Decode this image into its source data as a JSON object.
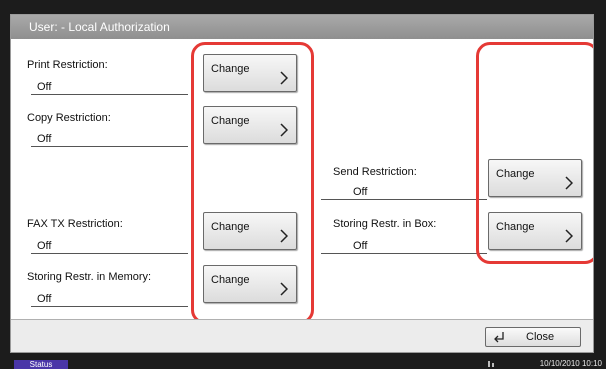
{
  "window": {
    "title": "User: - Local Authorization"
  },
  "rows": {
    "print": {
      "label": "Print Restriction:",
      "value": "Off",
      "button": "Change"
    },
    "copy": {
      "label": "Copy Restriction:",
      "value": "Off",
      "button": "Change"
    },
    "send": {
      "label": "Send Restriction:",
      "value": "Off",
      "button": "Change"
    },
    "fax": {
      "label": "FAX TX Restriction:",
      "value": "Off",
      "button": "Change"
    },
    "box": {
      "label": "Storing Restr. in Box:",
      "value": "Off",
      "button": "Change"
    },
    "memory": {
      "label": "Storing Restr. in Memory:",
      "value": "Off",
      "button": "Change"
    }
  },
  "footer": {
    "close_label": "Close"
  },
  "status_bar": {
    "status_label": "Status",
    "datetime": "10/10/2010  10:10"
  },
  "colors": {
    "highlight": "#e53935",
    "status_tab": "#4a36a8",
    "title_bar": "#a0a0a0"
  },
  "icons": {
    "chevron": "chevron-right-icon",
    "return": "return-arrow-icon",
    "network": "network-icon"
  }
}
